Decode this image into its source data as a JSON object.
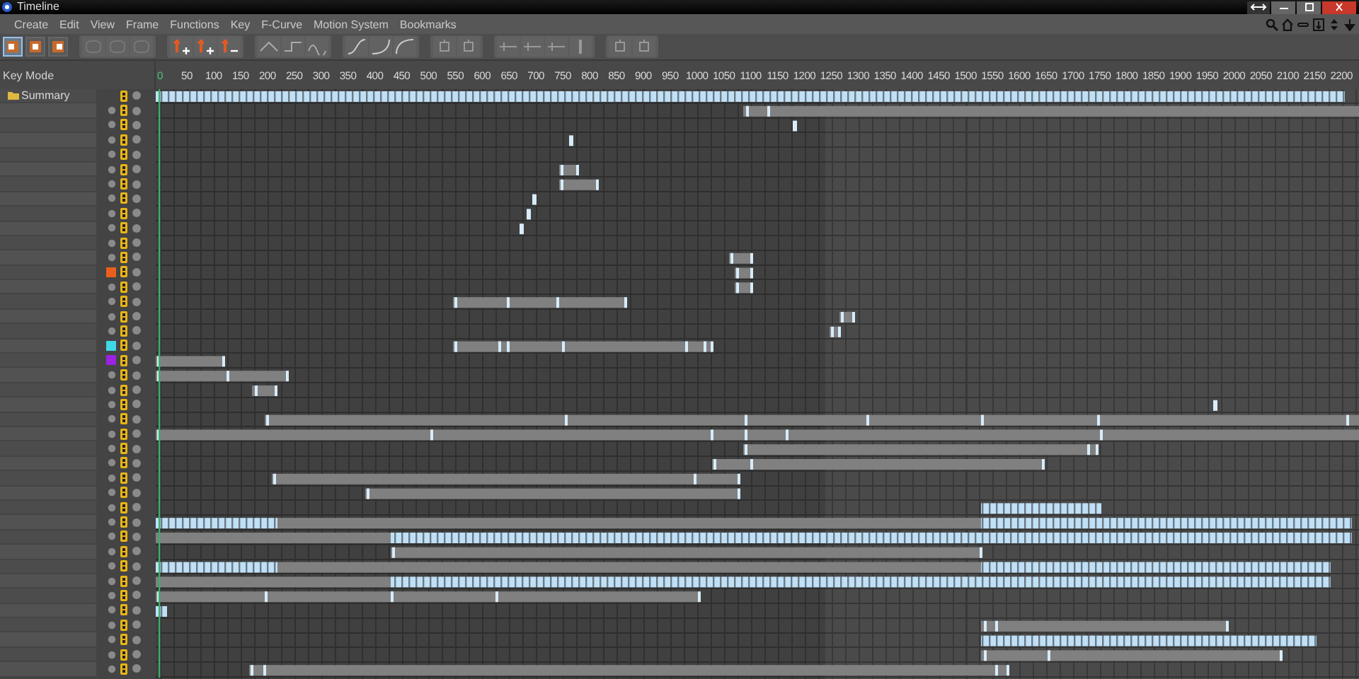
{
  "window": {
    "title": "Timeline"
  },
  "menu": [
    "Create",
    "Edit",
    "View",
    "Frame",
    "Functions",
    "Key",
    "F-Curve",
    "Motion System",
    "Bookmarks"
  ],
  "mode_buttons": [
    {
      "selected": true
    },
    {
      "selected": false
    },
    {
      "selected": false
    }
  ],
  "key_mode_label": "Key Mode",
  "ruler": [
    "0",
    "50",
    "100",
    "150",
    "200",
    "250",
    "300",
    "350",
    "400",
    "450",
    "500",
    "550",
    "600",
    "650",
    "700",
    "750",
    "800",
    "850",
    "900",
    "950",
    "1000",
    "1050",
    "1100",
    "1150",
    "1200",
    "1250",
    "1300",
    "1350",
    "1400",
    "1450",
    "1500",
    "1550",
    "1600",
    "1650",
    "1700",
    "1750",
    "1800",
    "1850",
    "1900",
    "1950",
    "2000",
    "2050",
    "2100",
    "2150",
    "2200"
  ],
  "tracks": [
    {
      "kind": "summary",
      "label": "Summary"
    },
    {
      "kind": "track"
    },
    {
      "kind": "track"
    },
    {
      "kind": "track"
    },
    {
      "kind": "track"
    },
    {
      "kind": "track"
    },
    {
      "kind": "track"
    },
    {
      "kind": "track"
    },
    {
      "kind": "track"
    },
    {
      "kind": "track"
    },
    {
      "kind": "track"
    },
    {
      "kind": "track"
    },
    {
      "kind": "track",
      "color": "#e8601c"
    },
    {
      "kind": "track"
    },
    {
      "kind": "track"
    },
    {
      "kind": "track"
    },
    {
      "kind": "track"
    },
    {
      "kind": "track",
      "color": "#3fd8e6"
    },
    {
      "kind": "track",
      "color": "#9a22e0"
    },
    {
      "kind": "track"
    },
    {
      "kind": "track"
    },
    {
      "kind": "track"
    },
    {
      "kind": "track"
    },
    {
      "kind": "track"
    },
    {
      "kind": "track"
    },
    {
      "kind": "track"
    },
    {
      "kind": "track"
    },
    {
      "kind": "track"
    },
    {
      "kind": "track"
    },
    {
      "kind": "track"
    },
    {
      "kind": "track"
    },
    {
      "kind": "track"
    },
    {
      "kind": "track"
    },
    {
      "kind": "track"
    },
    {
      "kind": "track"
    },
    {
      "kind": "track"
    },
    {
      "kind": "track"
    },
    {
      "kind": "track"
    },
    {
      "kind": "track"
    },
    {
      "kind": "track"
    }
  ]
}
